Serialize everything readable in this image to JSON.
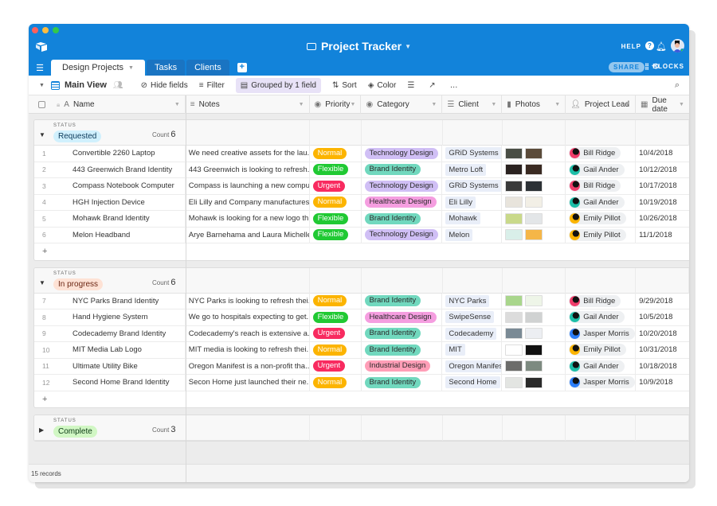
{
  "window": {
    "title": "Project Tracker",
    "help_label": "HELP",
    "share_label": "SHARE",
    "blocks_label": "BLOCKS"
  },
  "tabs": [
    {
      "label": "Design Projects",
      "active": true
    },
    {
      "label": "Tasks",
      "active": false
    },
    {
      "label": "Clients",
      "active": false
    }
  ],
  "toolbar": {
    "view_name": "Main View",
    "hide_fields": "Hide fields",
    "filter": "Filter",
    "grouped": "Grouped by 1 field",
    "sort": "Sort",
    "color": "Color",
    "more": "…"
  },
  "columns": {
    "name": "Name",
    "notes": "Notes",
    "priority": "Priority",
    "category": "Category",
    "client": "Client",
    "photos": "Photos",
    "lead": "Project Lead",
    "due": "Due date"
  },
  "colors": {
    "brand": "#1283da",
    "priority": {
      "Normal": "#fcb400",
      "Flexible": "#20c933",
      "Urgent": "#f82b60"
    },
    "category": {
      "Technology Design": "#d0bff5",
      "Brand Identity": "#71d8be",
      "Healthcare Design": "#f59ee0",
      "Industrial Design": "#ff9eb7"
    },
    "status": {
      "Requested": {
        "bg": "#d0f0fd",
        "fg": "#0b3a5a"
      },
      "In progress": {
        "bg": "#fee2d5",
        "fg": "#6b2613"
      },
      "Complete": {
        "bg": "#d1f7c4",
        "fg": "#0b3b14"
      }
    },
    "leads": {
      "Bill Ridge": "#f03d6b",
      "Gail Ander": "#1dbfa8",
      "Emily Pillot": "#fcb400",
      "Jasper Morris": "#2d7ff9"
    }
  },
  "group_label": "STATUS",
  "count_label": "Count",
  "groups": [
    {
      "status": "Requested",
      "count": "6",
      "expanded": true,
      "rows": [
        {
          "num": "1",
          "name": "Convertible 2260 Laptop",
          "notes": "We need creative assets for the lau...",
          "priority": "Normal",
          "category": "Technology Design",
          "client": "GRiD Systems",
          "photos": [
            "#4a4e45",
            "#5b4b3a"
          ],
          "lead": "Bill Ridge",
          "due": "10/4/2018"
        },
        {
          "num": "2",
          "name": "443 Greenwich Brand Identity",
          "notes": "443 Greenwich is looking to refresh...",
          "priority": "Flexible",
          "category": "Brand Identity",
          "client": "Metro Loft",
          "photos": [
            "#2a2220",
            "#3a2a22"
          ],
          "lead": "Gail Ander",
          "due": "10/12/2018"
        },
        {
          "num": "3",
          "name": "Compass Notebook Computer",
          "notes": "Compass is launching a new compu...",
          "priority": "Urgent",
          "category": "Technology Design",
          "client": "GRiD Systems",
          "photos": [
            "#3a3a3a",
            "#2c3135"
          ],
          "lead": "Bill Ridge",
          "due": "10/17/2018"
        },
        {
          "num": "4",
          "name": "HGH Injection Device",
          "notes": "Eli Lilly and Company manufactures...",
          "priority": "Normal",
          "category": "Healthcare Design",
          "client": "Eli Lilly",
          "photos": [
            "#e8e4dc",
            "#f2efe6"
          ],
          "lead": "Gail Ander",
          "due": "10/19/2018"
        },
        {
          "num": "5",
          "name": "Mohawk Brand Identity",
          "notes": "Mohawk is looking for a new logo th...",
          "priority": "Flexible",
          "category": "Brand Identity",
          "client": "Mohawk",
          "photos": [
            "#c9d98a",
            "#e3e6e8"
          ],
          "lead": "Emily Pillot",
          "due": "10/26/2018"
        },
        {
          "num": "6",
          "name": "Melon Headband",
          "notes": "Arye Barnehama and Laura Michelle...",
          "priority": "Flexible",
          "category": "Technology Design",
          "client": "Melon",
          "photos": [
            "#d9efe9",
            "#f5b648"
          ],
          "lead": "Emily Pillot",
          "due": "11/1/2018"
        }
      ]
    },
    {
      "status": "In progress",
      "count": "6",
      "expanded": true,
      "rows": [
        {
          "num": "7",
          "name": "NYC Parks Brand Identity",
          "notes": "NYC Parks is looking to refresh thei...",
          "priority": "Normal",
          "category": "Brand Identity",
          "client": "NYC Parks",
          "photos": [
            "#a9d68c",
            "#eef5e8"
          ],
          "lead": "Bill Ridge",
          "due": "9/29/2018"
        },
        {
          "num": "8",
          "name": "Hand Hygiene System",
          "notes": "We go to hospitals expecting to get...",
          "priority": "Flexible",
          "category": "Healthcare Design",
          "client": "SwipeSense",
          "photos": [
            "#dcdcdc",
            "#d0d2d2"
          ],
          "lead": "Gail Ander",
          "due": "10/5/2018"
        },
        {
          "num": "9",
          "name": "Codecademy Brand Identity",
          "notes": "Codecademy's reach is extensive a...",
          "priority": "Urgent",
          "category": "Brand Identity",
          "client": "Codecademy",
          "photos": [
            "#7a8a95",
            "#eceef2"
          ],
          "lead": "Jasper Morris",
          "due": "10/20/2018"
        },
        {
          "num": "10",
          "name": "MIT Media Lab Logo",
          "notes": "MIT media is looking to refresh thei...",
          "priority": "Normal",
          "category": "Brand Identity",
          "client": "MIT",
          "photos": [
            "#ffffff",
            "#111111"
          ],
          "lead": "Emily Pillot",
          "due": "10/31/2018"
        },
        {
          "num": "11",
          "name": "Ultimate Utility Bike",
          "notes": "Oregon Manifest is a non-profit tha...",
          "priority": "Urgent",
          "category": "Industrial Design",
          "client": "Oregon Manifest",
          "photos": [
            "#6c6c6a",
            "#7d8a80"
          ],
          "lead": "Gail Ander",
          "due": "10/18/2018"
        },
        {
          "num": "12",
          "name": "Second Home Brand Identity",
          "notes": "Secon Home just launched their ne...",
          "priority": "Normal",
          "category": "Brand Identity",
          "client": "Second Home",
          "photos": [
            "#e3e5e2",
            "#2a2a2a"
          ],
          "lead": "Jasper Morris",
          "due": "10/9/2018"
        }
      ]
    },
    {
      "status": "Complete",
      "count": "3",
      "expanded": false,
      "rows": []
    }
  ],
  "footer": {
    "records": "15 records"
  }
}
